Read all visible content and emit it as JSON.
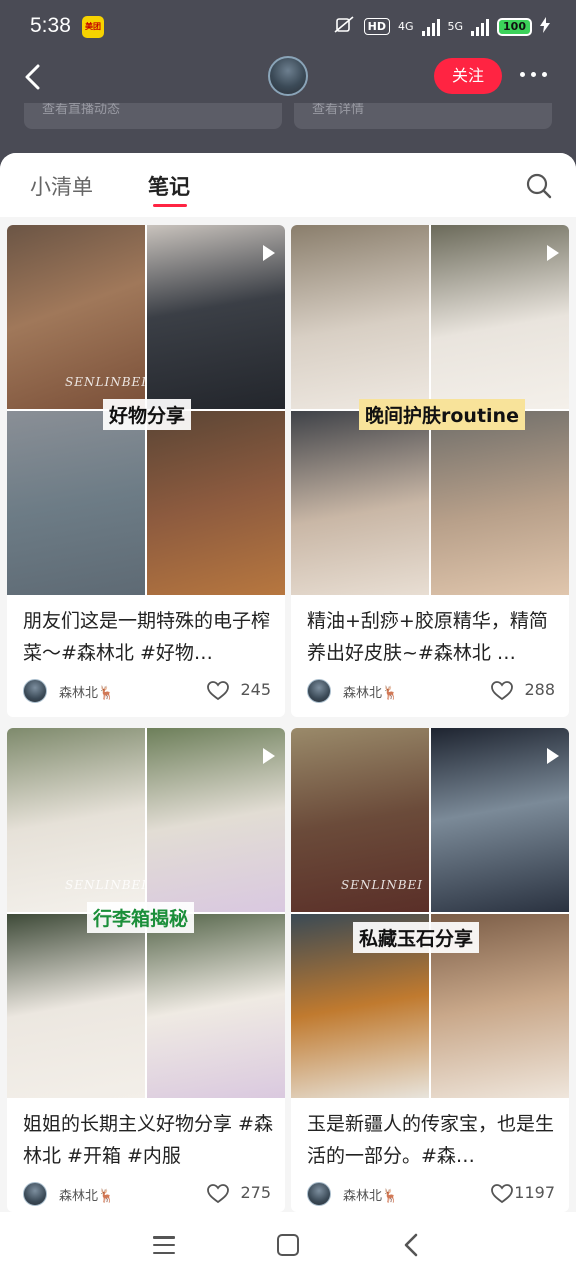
{
  "status_bar": {
    "time": "5:38",
    "app_badge": "美团",
    "hd": "HD",
    "net1": "4G",
    "net2": "5G",
    "battery": "100"
  },
  "nav": {
    "follow_label": "关注"
  },
  "peek": {
    "left": "查看直播动态",
    "right": "查看详情"
  },
  "tabs": {
    "list": "小清单",
    "notes": "笔记"
  },
  "notes": [
    {
      "overlay": "好物分享",
      "watermark": "SENLINBEI",
      "title": "朋友们这是一期特殊的电子榨菜～#森林北 #好物…",
      "author": "森林北🦌",
      "likes": "245"
    },
    {
      "overlay": "晚间护肤routine",
      "watermark": "",
      "title": "精油+刮痧+胶原精华，精简养出好皮肤~#森林北 …",
      "author": "森林北🦌",
      "likes": "288"
    },
    {
      "overlay": "行李箱揭秘",
      "watermark": "SENLINBEI",
      "title": "姐姐的长期主义好物分享 #森林北 #开箱 #内服",
      "author": "森林北🦌",
      "likes": "275"
    },
    {
      "overlay": "私藏玉石分享",
      "watermark": "SENLINBEI",
      "title": "玉是新疆人的传家宝，也是生活的一部分。#森…",
      "author": "森林北🦌",
      "likes": "1197"
    }
  ],
  "colors": {
    "accent": "#ff2442",
    "header_bg": "#4a4b55"
  }
}
